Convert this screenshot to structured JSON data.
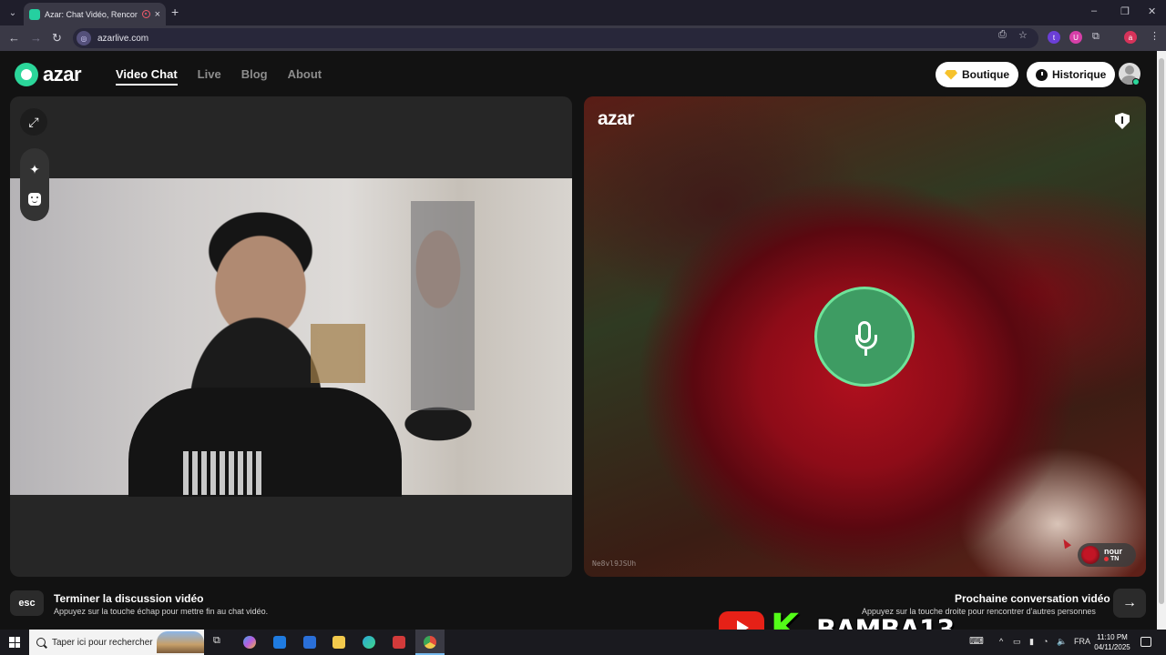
{
  "browser": {
    "tab_title": "Azar: Chat Vidéo, Rencontre",
    "tab_close": "×",
    "new_tab": "+",
    "url": "azarlive.com",
    "window_controls": [
      "–",
      "❐",
      "✕"
    ],
    "nav": [
      "←",
      "→",
      "↻"
    ],
    "extensions": [
      {
        "label": "t",
        "color": "#6b3fd6"
      },
      {
        "label": "U",
        "color": "#d63fa8"
      },
      {
        "label": "a",
        "color": "#d6335a"
      }
    ]
  },
  "site": {
    "logo_text": "azar",
    "nav": [
      {
        "label": "Video Chat",
        "active": true
      },
      {
        "label": "Live",
        "active": false
      },
      {
        "label": "Blog",
        "active": false
      },
      {
        "label": "About",
        "active": false
      }
    ],
    "boutique_label": "Boutique",
    "historique_label": "Historique"
  },
  "left_panel": {
    "tools": [
      "expand-icon",
      "sparkle-icon",
      "face-filter-icon"
    ],
    "sparkle_glyph": "✦",
    "expand_glyph": "⤢"
  },
  "right_panel": {
    "logo_text": "azar",
    "peer_id": "Ne8vl9JSUh",
    "peer_name": "nour",
    "peer_country": "TN",
    "mic_state": "on"
  },
  "hints": {
    "esc_key": "esc",
    "end_title": "Terminer la discussion vidéo",
    "end_sub": "Appuyez sur la touche échap pour mettre fin au chat vidéo.",
    "next_title": "Prochaine conversation vidéo",
    "next_sub": "Appuyez sur la touche droite pour rencontrer d'autres personnes",
    "next_glyph": "→"
  },
  "overlay": {
    "kick_letter": "K",
    "channel": "BAMBA13"
  },
  "taskbar": {
    "search_placeholder": "Taper ici pour rechercher",
    "language": "FRA",
    "time": "11:10 PM",
    "date": "04/11/2025",
    "app_colors": [
      "#4aa3e8",
      "#f0b23a",
      "#1f7be0",
      "#f2c94c",
      "#2aa9d8",
      "#d23a3a",
      "#e04b3c"
    ]
  }
}
